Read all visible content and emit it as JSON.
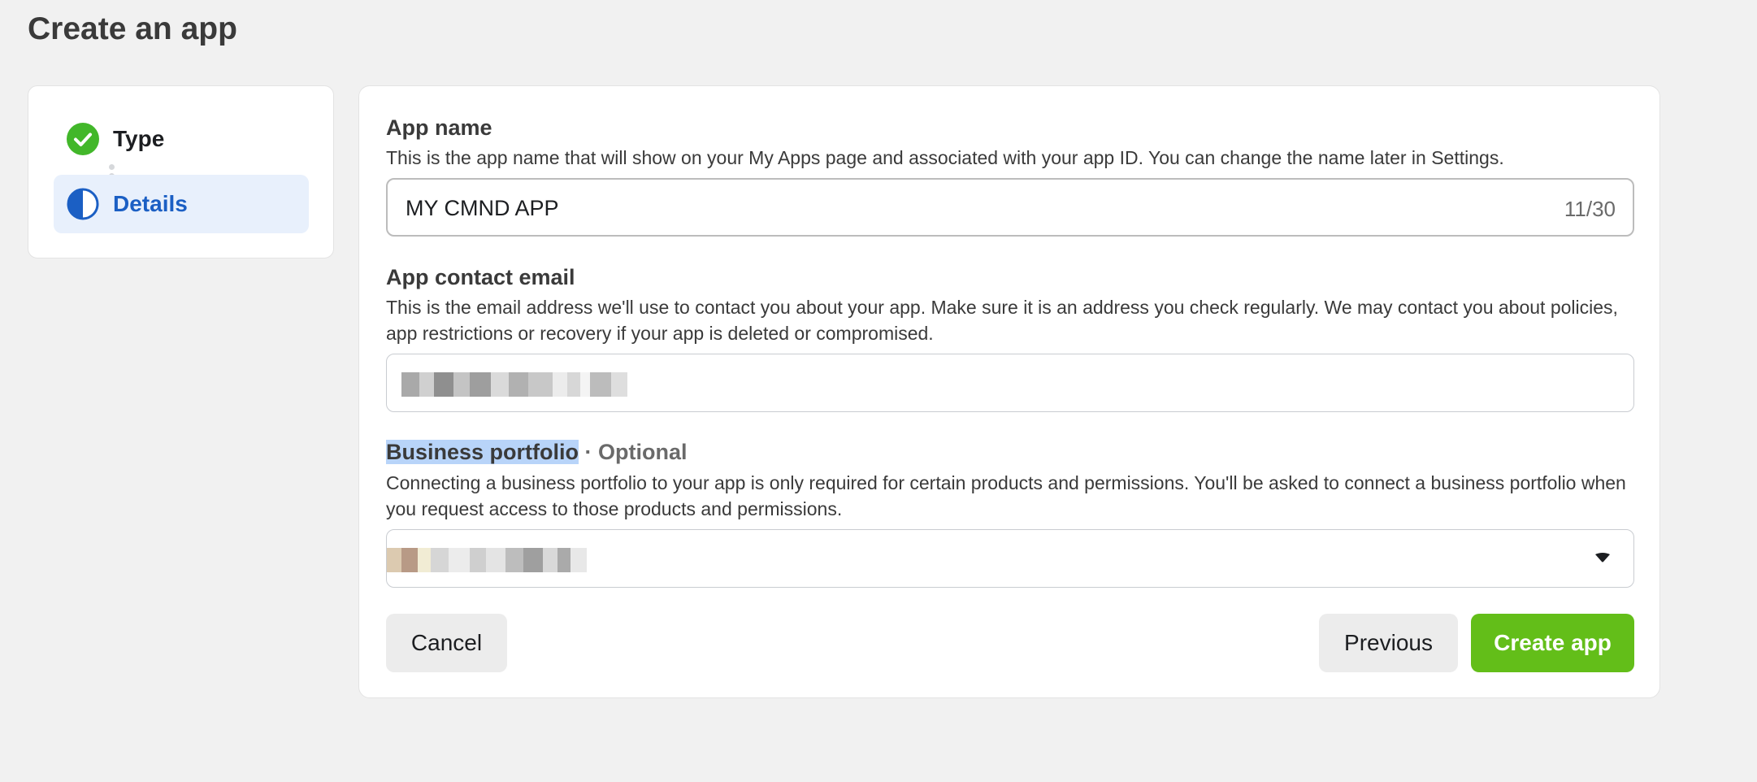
{
  "page": {
    "title": "Create an app"
  },
  "stepper": {
    "steps": [
      {
        "label": "Type",
        "state": "complete",
        "icon": "check-circle-icon",
        "color": "#42b72a"
      },
      {
        "label": "Details",
        "state": "current",
        "icon": "half-circle-icon",
        "color": "#1b5fc4"
      }
    ]
  },
  "form": {
    "app_name": {
      "label": "App name",
      "help": "This is the app name that will show on your My Apps page and associated with your app ID. You can change the name later in Settings.",
      "value": "MY CMND APP",
      "counter": "11/30"
    },
    "contact_email": {
      "label": "App contact email",
      "help": "This is the email address we'll use to contact you about your app. Make sure it is an address you check regularly. We may contact you about policies, app restrictions or recovery if your app is deleted or compromised."
    },
    "business_portfolio": {
      "label": "Business portfolio",
      "optional": " · Optional",
      "help": "Connecting a business portfolio to your app is only required for certain products and permissions. You'll be asked to connect a business portfolio when you request access to those products and permissions.",
      "dropdown_icon": "chevron-down-icon"
    }
  },
  "actions": {
    "cancel": "Cancel",
    "previous": "Previous",
    "create": "Create app",
    "create_color": "#63be19"
  }
}
